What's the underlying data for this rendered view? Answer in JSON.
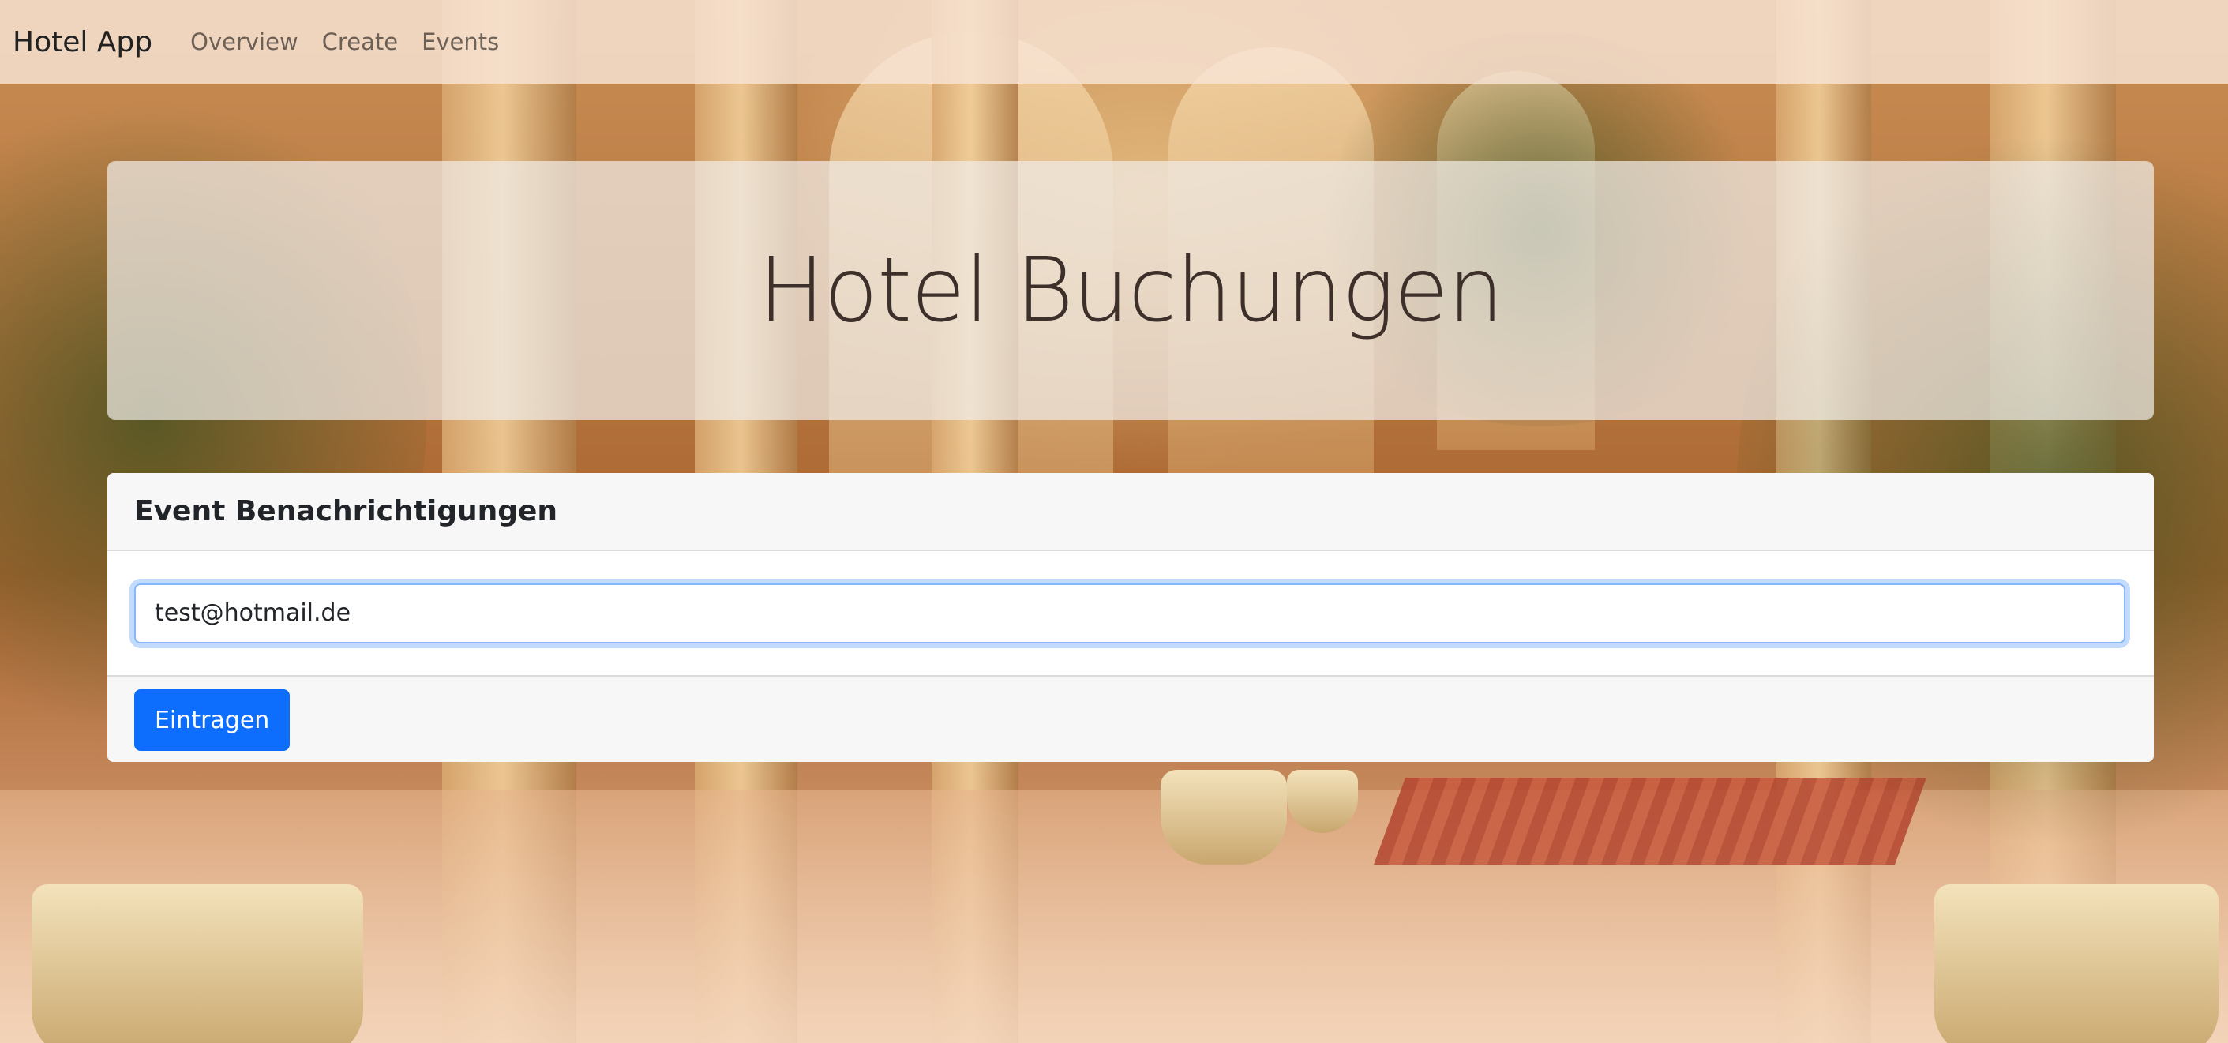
{
  "navbar": {
    "brand": "Hotel App",
    "links": [
      {
        "label": "Overview"
      },
      {
        "label": "Create"
      },
      {
        "label": "Events"
      }
    ]
  },
  "hero": {
    "title": "Hotel Buchungen"
  },
  "event_card": {
    "title": "Event Benachrichtigungen",
    "email_value": "test@hotmail.de",
    "submit_label": "Eintragen"
  },
  "colors": {
    "primary": "#0d6efd",
    "focus_ring": "#86b7fe"
  }
}
